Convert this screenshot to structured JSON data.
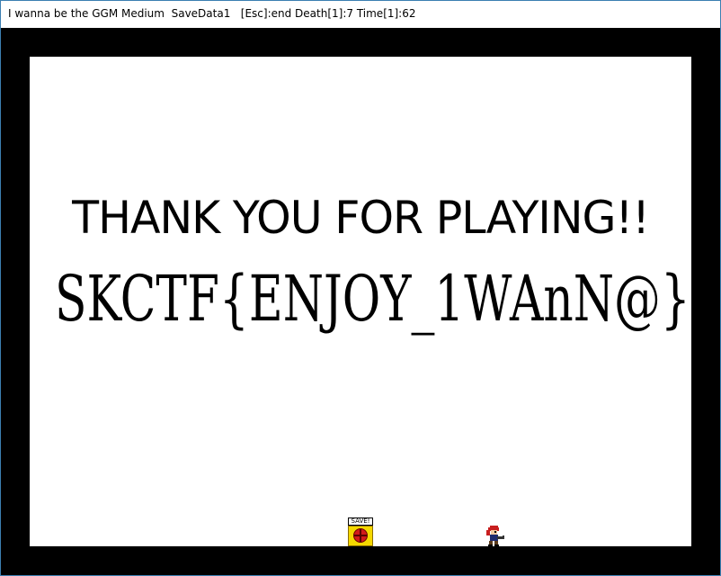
{
  "window": {
    "title": "I wanna be the GGM Medium  SaveData1   [Esc]:end Death[1]:7 Time[1]:62"
  },
  "game": {
    "thanks_text": "THANK YOU FOR PLAYING!!",
    "flag_text": "SKCTF{ENJOY_1WAnN@}",
    "save_point_label": "SAVE!"
  },
  "colors": {
    "border": "#000000",
    "background": "#ffffff",
    "save_box": "#f5d800",
    "save_orb": "#d21a1a",
    "kid_hair": "#c81e1e",
    "kid_body": "#1e2a6e"
  },
  "icons": {
    "save_point": "save-point-icon",
    "player": "kid-character-icon"
  }
}
